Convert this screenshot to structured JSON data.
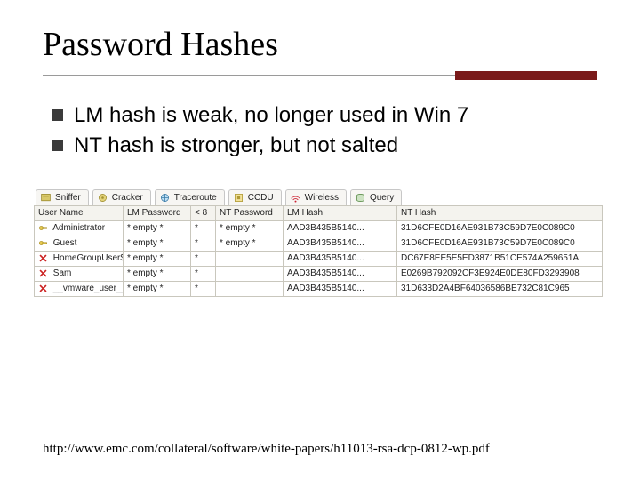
{
  "title": "Password Hashes",
  "bullets": [
    "LM hash is weak, no longer used in Win 7",
    "NT hash is stronger, but not salted"
  ],
  "tabs": [
    {
      "icon": "sniffer-icon",
      "label": "Sniffer"
    },
    {
      "icon": "cracker-icon",
      "label": "Cracker"
    },
    {
      "icon": "traceroute-icon",
      "label": "Traceroute"
    },
    {
      "icon": "ccdu-icon",
      "label": "CCDU"
    },
    {
      "icon": "wireless-icon",
      "label": "Wireless"
    },
    {
      "icon": "query-icon",
      "label": "Query"
    }
  ],
  "columns": {
    "user": "User Name",
    "lmpw": "LM Password",
    "lt8": "< 8",
    "ntpw": "NT Password",
    "lmhash": "LM Hash",
    "nthash": "NT Hash"
  },
  "rows": [
    {
      "icon": "key",
      "user": "Administrator",
      "lmpw": "* empty *",
      "lt8": "*",
      "ntpw": "* empty *",
      "lmhash": "AAD3B435B5140...",
      "nthash": "31D6CFE0D16AE931B73C59D7E0C089C0"
    },
    {
      "icon": "key",
      "user": "Guest",
      "lmpw": "* empty *",
      "lt8": "*",
      "ntpw": "* empty *",
      "lmhash": "AAD3B435B5140...",
      "nthash": "31D6CFE0D16AE931B73C59D7E0C089C0"
    },
    {
      "icon": "x",
      "user": "HomeGroupUser$",
      "lmpw": "* empty *",
      "lt8": "*",
      "ntpw": "",
      "lmhash": "AAD3B435B5140...",
      "nthash": "DC67E8EE5E5ED3871B51CE574A259651A"
    },
    {
      "icon": "x",
      "user": "Sam",
      "lmpw": "* empty *",
      "lt8": "*",
      "ntpw": "",
      "lmhash": "AAD3B435B5140...",
      "nthash": "E0269B792092CF3E924E0DE80FD3293908"
    },
    {
      "icon": "x",
      "user": "__vmware_user__",
      "lmpw": "* empty *",
      "lt8": "*",
      "ntpw": "",
      "lmhash": "AAD3B435B5140...",
      "nthash": "31D633D2A4BF64036586BE732C81C965"
    }
  ],
  "footer_link": "http://www.emc.com/collateral/software/white-papers/h11013-rsa-dcp-0812-wp.pdf"
}
